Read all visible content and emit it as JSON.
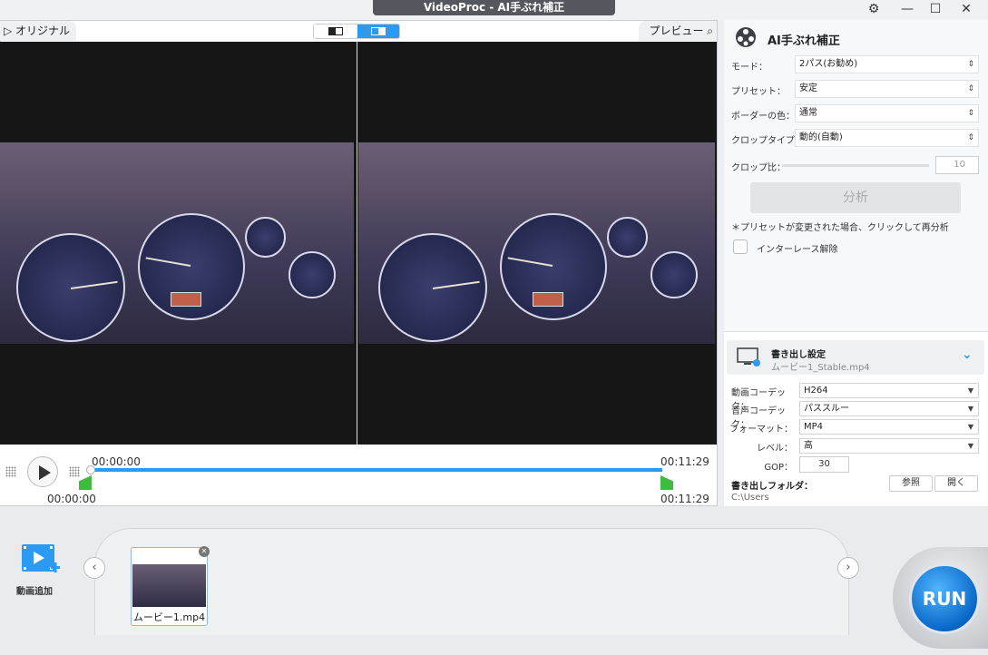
{
  "window": {
    "title": "VideoProc - AI手ぶれ補正",
    "controls": [
      "minimize",
      "maximize",
      "close"
    ]
  },
  "preview": {
    "original_label": "▷ オリジナル",
    "preview_label": "プレビュー",
    "time_start_top": "00:00:00",
    "time_end_top": "00:11:29",
    "time_start_bottom": "00:00:00",
    "time_end_bottom": "00:11:29",
    "progress_fraction": 0.0
  },
  "stabilize": {
    "title": "AI手ぶれ補正",
    "fields": [
      {
        "label": "モード：",
        "value": "2パス(お勧め)"
      },
      {
        "label": "プリセット：",
        "value": "安定"
      },
      {
        "label": "ボーダーの色：",
        "value": "通常"
      },
      {
        "label": "クロップタイプ：",
        "value": "動的(自動)"
      }
    ],
    "crop_label": "クロップ比：",
    "crop_value": "10",
    "analyze_label": "分析",
    "note": "＊プリセットが変更された場合、クリックして再分析",
    "deinterlace_label": "インターレース解除",
    "deinterlace_checked": false
  },
  "export": {
    "title": "書き出し設定",
    "filename": "ムービー1_Stable.mp4",
    "fields": [
      {
        "label": "動画コーデック：",
        "value": "H264"
      },
      {
        "label": "音声コーデック：",
        "value": "パススルー"
      },
      {
        "label": "フォーマット：",
        "value": "MP4"
      },
      {
        "label": "レベル：",
        "value": "高"
      }
    ],
    "gop_label": "GOP：",
    "gop_value": "30",
    "folder_label": "書き出しフォルダ：",
    "folder_path": "C:\\Users",
    "browse_label": "参照",
    "open_label": "開く"
  },
  "bottom": {
    "add_video_label": "動画追加",
    "clip_label": "ムービー1.mp4",
    "run_label": "RUN"
  },
  "colors": {
    "accent": "#2b9af3",
    "marker": "#3ebc3e",
    "title_bar": "#54585e"
  }
}
